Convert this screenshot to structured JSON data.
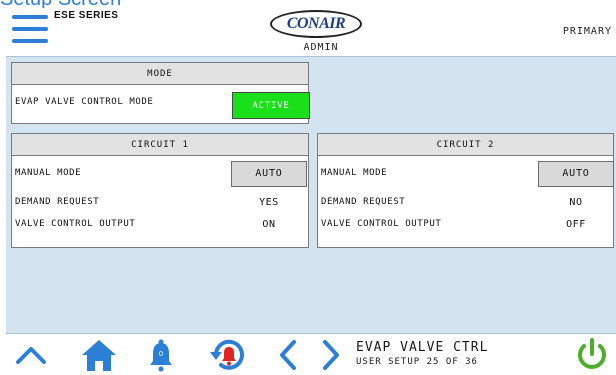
{
  "caption": "Setup Screen",
  "header": {
    "series": "ESE SERIES",
    "logo_text": "CONAIR",
    "user_level": "ADMIN",
    "unit_role": "PRIMARY"
  },
  "mode_panel": {
    "title": "MODE",
    "rows": [
      {
        "label": "EVAP VALVE CONTROL MODE",
        "value": "ACTIVE"
      }
    ]
  },
  "circuit1": {
    "title": "CIRCUIT 1",
    "manual_mode": {
      "label": "MANUAL MODE",
      "value": "AUTO"
    },
    "demand_request": {
      "label": "DEMAND REQUEST",
      "value": "YES"
    },
    "valve_output": {
      "label": "VALVE CONTROL OUTPUT",
      "value": "ON"
    }
  },
  "circuit2": {
    "title": "CIRCUIT 2",
    "manual_mode": {
      "label": "MANUAL MODE",
      "value": "AUTO"
    },
    "demand_request": {
      "label": "DEMAND REQUEST",
      "value": "NO"
    },
    "valve_output": {
      "label": "VALVE CONTROL OUTPUT",
      "value": "OFF"
    }
  },
  "footer": {
    "screen_title": "EVAP VALVE CTRL",
    "screen_subtitle": "USER SETUP 25 OF 36",
    "alarm_count": "0",
    "icons": [
      "up-arrow-icon",
      "home-icon",
      "alarm-bell-icon",
      "alarm-history-icon",
      "previous-arrow-icon",
      "next-arrow-icon",
      "power-icon"
    ]
  },
  "colors": {
    "accent_blue": "#2c7fd6",
    "active_green": "#19e019",
    "power_green": "#4caf2a",
    "alarm_red": "#e32222",
    "background_blue": "#d3e3f0"
  }
}
